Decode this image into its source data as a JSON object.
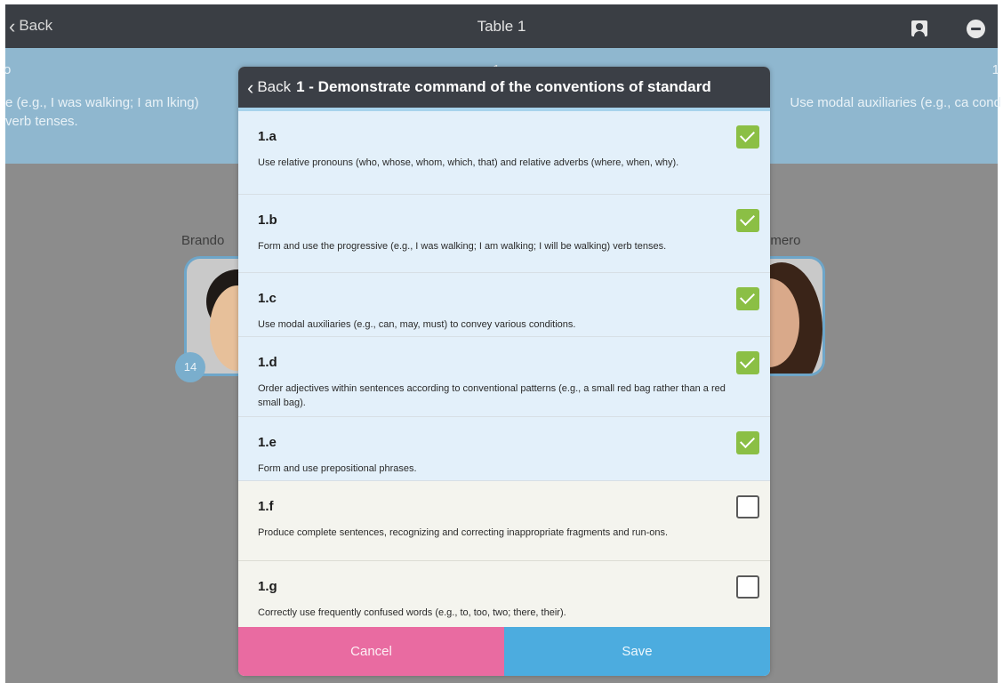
{
  "topbar": {
    "back_label": "Back",
    "title": "Table 1",
    "icons": [
      "person-icon",
      "menu-icon"
    ]
  },
  "banner": {
    "left_line1": "o",
    "left_line2": "e (e.g., I was walking; I am lking) verb tenses.",
    "center_line1": "1.c",
    "right_line1": "1",
    "right_line2": "Use modal auxiliaries (e.g., ca cond"
  },
  "students": [
    {
      "name": "Brando",
      "seat": "14"
    },
    {
      "name": "omero"
    }
  ],
  "modal": {
    "back_label": "Back",
    "title": "1 - Demonstrate command of the conventions of standard",
    "items": [
      {
        "code": "1.a",
        "text": "Use relative pronouns (who, whose, whom, which, that) and relative adverbs (where, when, why).",
        "checked": true
      },
      {
        "code": "1.b",
        "text": "Form and use the progressive (e.g., I was walking; I am walking; I will be walking) verb tenses.",
        "checked": true
      },
      {
        "code": "1.c",
        "text": "Use modal auxiliaries (e.g., can, may, must) to convey various conditions.",
        "checked": true
      },
      {
        "code": "1.d",
        "text": "Order adjectives within sentences according to conventional patterns (e.g., a small red bag rather than a red small bag).",
        "checked": true
      },
      {
        "code": "1.e",
        "text": "Form and use prepositional phrases.",
        "checked": true
      },
      {
        "code": "1.f",
        "text": "Produce complete sentences, recognizing and correcting inappropriate fragments and run-ons.",
        "checked": false
      },
      {
        "code": "1.g",
        "text": "Correctly use frequently confused words (e.g., to, too, two; there, their).",
        "checked": false
      }
    ],
    "cancel_label": "Cancel",
    "save_label": "Save"
  },
  "colors": {
    "header": "#3b3f46",
    "checked_bg": "#e3f0fa",
    "check_green": "#8bbf45",
    "cancel": "#e96ba1",
    "save": "#4cacdf"
  }
}
